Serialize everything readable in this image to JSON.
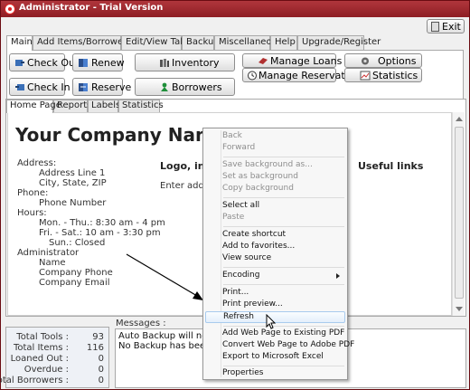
{
  "window": {
    "title": "Administrator - Trial Version",
    "exit_label": "Exit"
  },
  "main_tabs": [
    {
      "label": "Main",
      "active": true
    },
    {
      "label": "Add Items/Borrowers",
      "active": false
    },
    {
      "label": "Edit/View Table",
      "active": false
    },
    {
      "label": "Backup",
      "active": false
    },
    {
      "label": "Miscellaneous",
      "active": false
    },
    {
      "label": "Help",
      "active": false
    },
    {
      "label": "Upgrade/Register",
      "active": false
    }
  ],
  "toolbar": {
    "check_out": "Check Out",
    "renew": "Renew",
    "inventory": "Inventory",
    "manage_loans": "Manage Loans",
    "options": "Options",
    "check_in": "Check In",
    "reserve": "Reserve",
    "borrowers": "Borrowers",
    "manage_reservations": "Manage Reservations",
    "statistics": "Statistics"
  },
  "sub_tabs": [
    {
      "label": "Home Page",
      "active": true
    },
    {
      "label": "Reports",
      "active": false
    },
    {
      "label": "Labels",
      "active": false
    },
    {
      "label": "Statistics",
      "active": false
    }
  ],
  "home_page": {
    "company_name": "Your Company Name",
    "address_label": "Address:",
    "address_line": "Address Line 1",
    "city_line": "City, State, ZIP",
    "phone_label": "Phone:",
    "phone_number": "Phone Number",
    "hours_label": "Hours:",
    "hours_mon_thu": "Mon. - Thu.: 8:30 am - 4 pm",
    "hours_fri_sat": "Fri. - Sat.: 10 am - 3:30 pm",
    "hours_sun": "Sun.: Closed",
    "admin_label": "Administrator",
    "admin_name": "Name",
    "admin_phone": "Company Phone",
    "admin_email": "Company Email",
    "logo_heading": "Logo, info",
    "enter_text": "Enter additi",
    "useful_links": "Useful links"
  },
  "stats": {
    "total_tools_label": "Total Tools :",
    "total_tools": "93",
    "total_items_label": "Total Items :",
    "total_items": "116",
    "loaned_out_label": "Loaned Out :",
    "loaned_out": "0",
    "overdue_label": "Overdue :",
    "overdue": "0",
    "total_borrowers_label": "Total Borrowers :",
    "total_borrowers": "0"
  },
  "messages": {
    "label": "Messages :",
    "line1": "Auto Backup will not be",
    "line2": "No Backup has been do"
  },
  "context_menu": {
    "back": "Back",
    "forward": "Forward",
    "save_background": "Save background as...",
    "set_background": "Set as background",
    "copy_background": "Copy background",
    "select_all": "Select all",
    "paste": "Paste",
    "create_shortcut": "Create shortcut",
    "add_favorites": "Add to favorites...",
    "view_source": "View source",
    "encoding": "Encoding",
    "print": "Print...",
    "print_preview": "Print preview...",
    "refresh": "Refresh",
    "add_pdf": "Add Web Page to Existing PDF",
    "convert_pdf": "Convert Web Page to Adobe PDF",
    "export_excel": "Export to Microsoft Excel",
    "properties": "Properties"
  },
  "colors": {
    "titlebar": "#9e2a30",
    "menu_hover": "#e4effb"
  }
}
